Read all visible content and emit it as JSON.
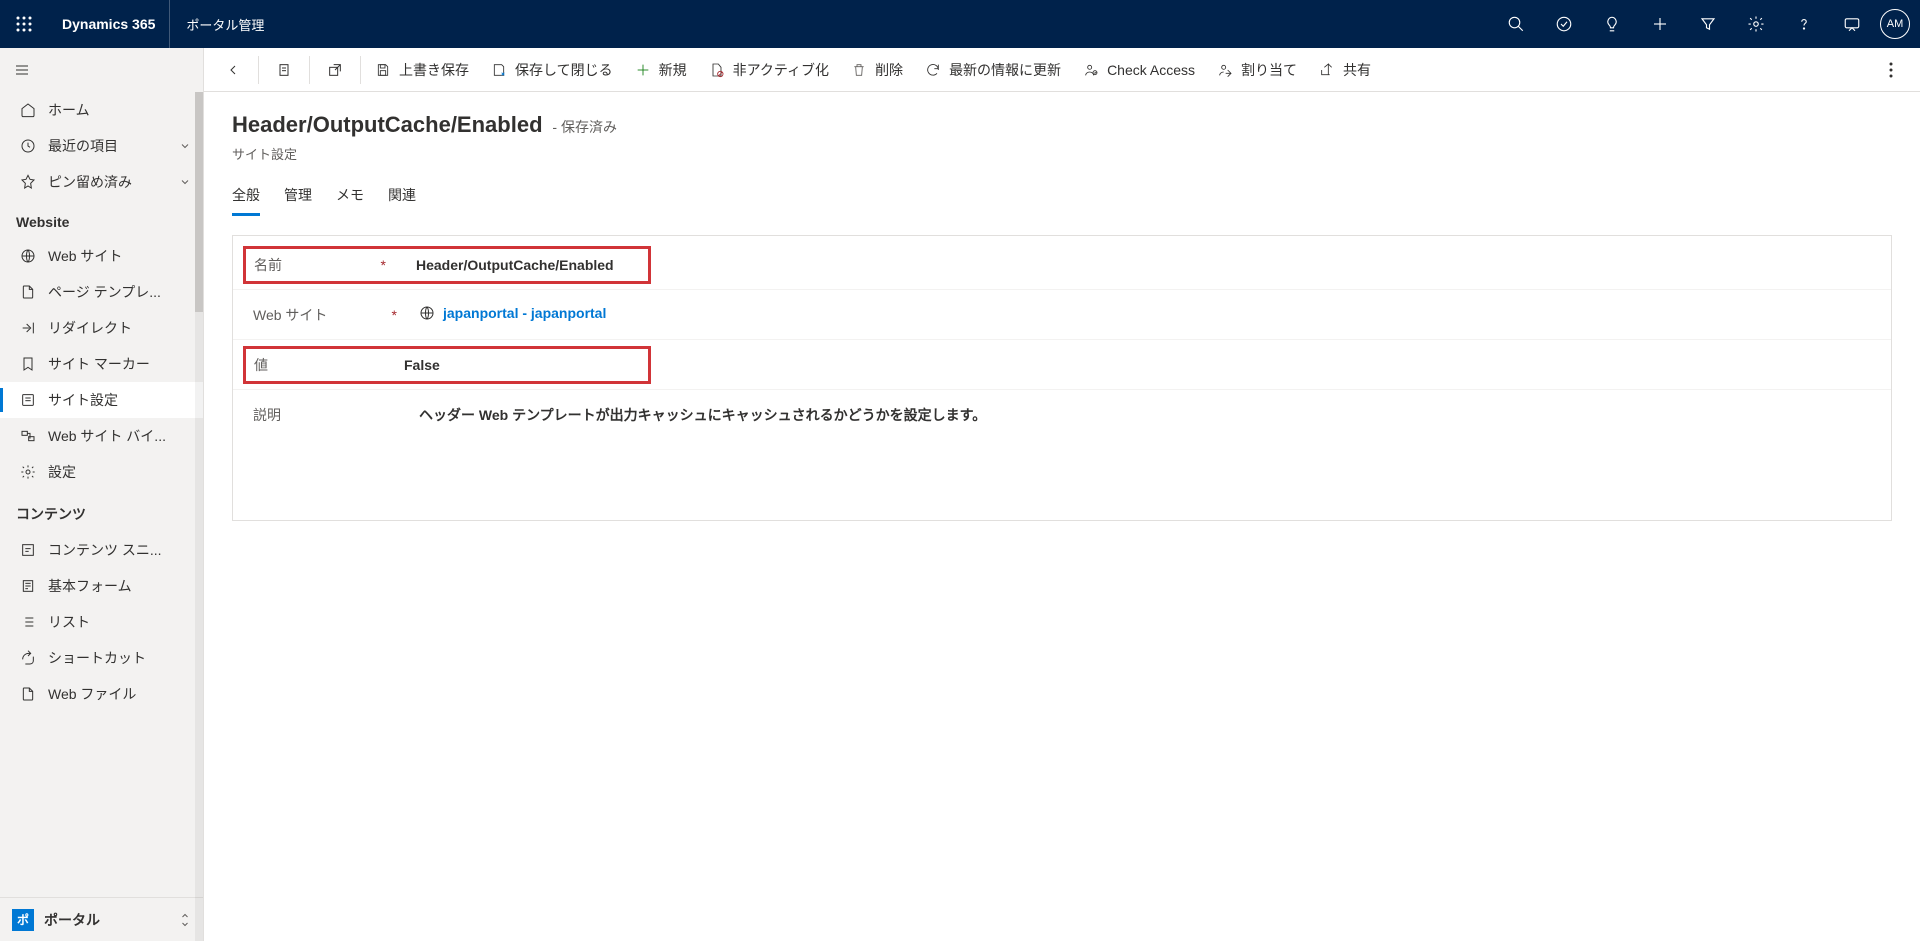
{
  "suite": {
    "brand": "Dynamics 365",
    "app_name": "ポータル管理",
    "avatar_initials": "AM"
  },
  "nav": {
    "home": "ホーム",
    "recent": "最近の項目",
    "pinned": "ピン留め済み",
    "group_website": "Website",
    "web_sites": "Web サイト",
    "page_templates": "ページ テンプレ...",
    "redirects": "リダイレクト",
    "site_markers": "サイト マーカー",
    "site_settings": "サイト設定",
    "web_site_bindings": "Web サイト バイ...",
    "settings": "設定",
    "group_contents": "コンテンツ",
    "content_snippets": "コンテンツ スニ...",
    "basic_forms": "基本フォーム",
    "lists": "リスト",
    "shortcuts": "ショートカット",
    "web_files": "Web ファイル",
    "area_label": "ポータル",
    "area_tile": "ポ"
  },
  "cmd": {
    "save": "上書き保存",
    "save_close": "保存して閉じる",
    "new": "新規",
    "deactivate": "非アクティブ化",
    "delete": "削除",
    "refresh": "最新の情報に更新",
    "check_access": "Check Access",
    "assign": "割り当て",
    "share": "共有"
  },
  "record": {
    "title": "Header/OutputCache/Enabled",
    "status": "- 保存済み",
    "subtitle": "サイト設定",
    "tabs": {
      "general": "全般",
      "admin": "管理",
      "memo": "メモ",
      "related": "関連"
    },
    "fields": {
      "name_label": "名前",
      "name_value": "Header/OutputCache/Enabled",
      "website_label": "Web サイト",
      "website_value": "japanportal - japanportal",
      "value_label": "値",
      "value_value": "False",
      "desc_label": "説明",
      "desc_value": "ヘッダー Web テンプレートが出力キャッシュにキャッシュされるかどうかを設定します。"
    }
  }
}
